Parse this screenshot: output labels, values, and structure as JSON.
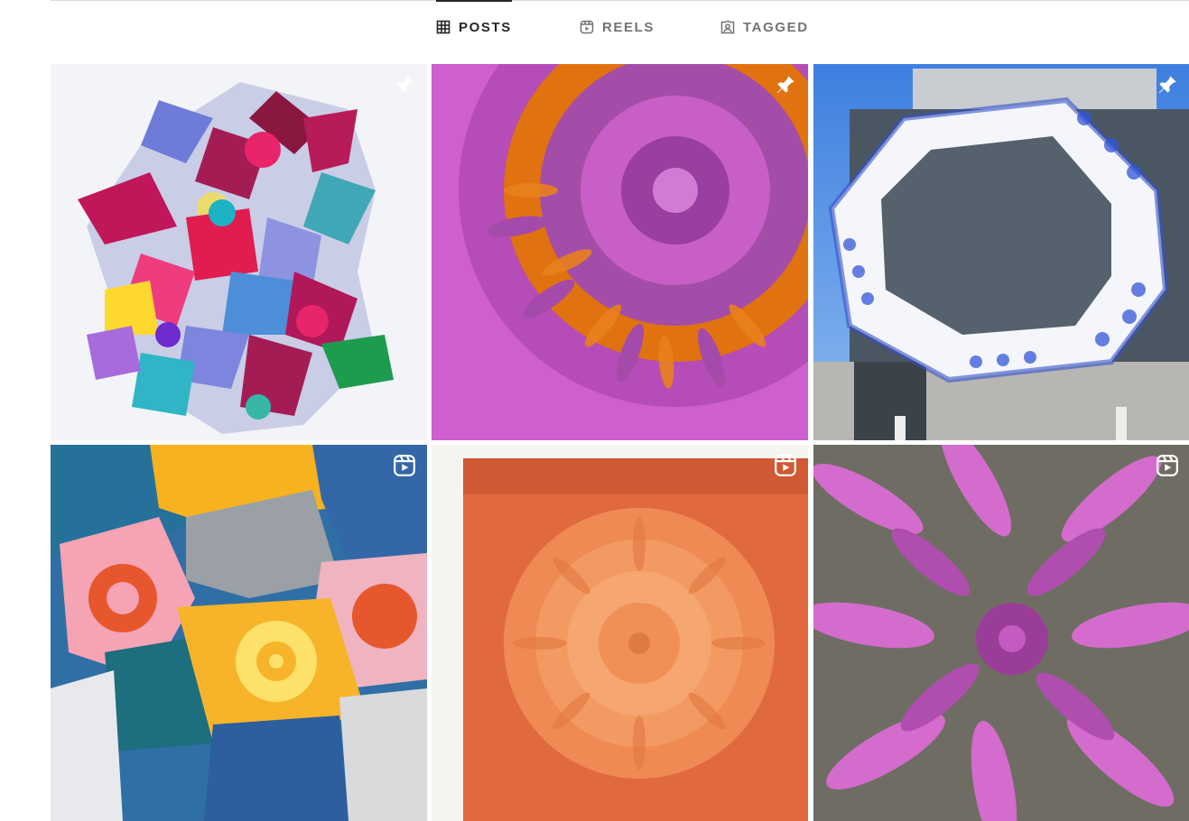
{
  "tabs": [
    {
      "label": "POSTS",
      "icon": "grid-icon",
      "active": true
    },
    {
      "label": "REELS",
      "icon": "reels-icon",
      "active": false
    },
    {
      "label": "TAGGED",
      "icon": "tagged-icon",
      "active": false
    }
  ],
  "posts": [
    {
      "badge": "pin-icon",
      "subject": "colorful patterned paper collage star cluster"
    },
    {
      "badge": "pin-icon",
      "subject": "pink and orange paper petal sculpture"
    },
    {
      "badge": "pin-icon",
      "subject": "blue patterned octagon frame on building"
    },
    {
      "badge": "reels-icon",
      "subject": "printed paper collage pieces"
    },
    {
      "badge": "reels-icon",
      "subject": "orange paper sculpture in frame"
    },
    {
      "badge": "reels-icon",
      "subject": "pink paper petal sculpture close-up"
    }
  ],
  "colors": {
    "active_tab": "#262626",
    "inactive_tab": "#737373",
    "divider": "#dbdbdb"
  }
}
